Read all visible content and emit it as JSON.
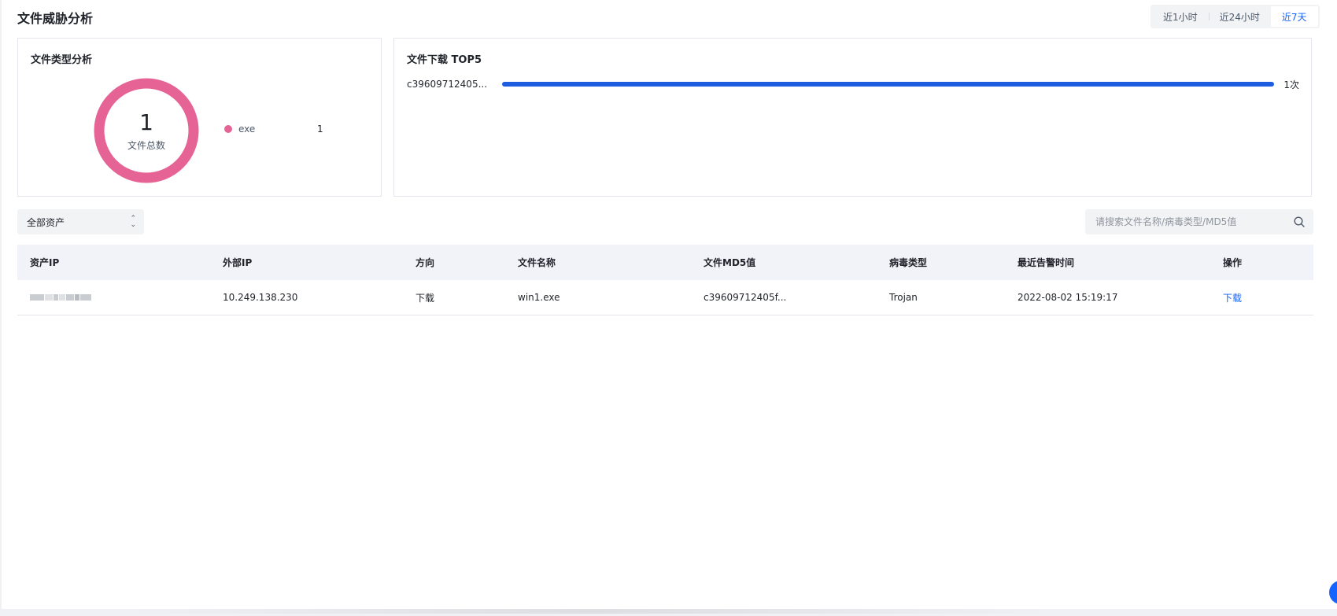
{
  "page": {
    "title": "文件威胁分析"
  },
  "time_range": {
    "options": [
      "近1小时",
      "近24小时",
      "近7天"
    ],
    "selected": "近7天"
  },
  "file_type_card": {
    "title": "文件类型分析",
    "total_value": "1",
    "total_label": "文件总数",
    "legend": [
      {
        "name": "exe",
        "value": "1",
        "color": "#e66395"
      }
    ]
  },
  "download_top_card": {
    "title": "文件下载 TOP5",
    "items": [
      {
        "label": "c39609712405...",
        "count": "1次",
        "fraction": 1.0
      }
    ],
    "bar_color": "#1f5de0"
  },
  "filters": {
    "asset_select": {
      "value": "全部资产"
    },
    "search": {
      "placeholder": "请搜索文件名称/病毒类型/MD5值"
    }
  },
  "table": {
    "columns": [
      "资产IP",
      "外部IP",
      "方向",
      "文件名称",
      "文件MD5值",
      "病毒类型",
      "最近告警时间",
      "操作"
    ],
    "rows": [
      {
        "asset_ip": "",
        "external_ip": "10.249.138.230",
        "direction": "下载",
        "file_name": "win1.exe",
        "md5": "c39609712405f...",
        "virus_type": "Trojan",
        "last_alert": "2022-08-02 15:19:17",
        "action": "下载"
      }
    ]
  },
  "colors": {
    "accent": "#1664ff",
    "donut": "#e66395"
  },
  "icons": {
    "search": "search-icon",
    "select_arrow": "chevron-updown-icon"
  }
}
